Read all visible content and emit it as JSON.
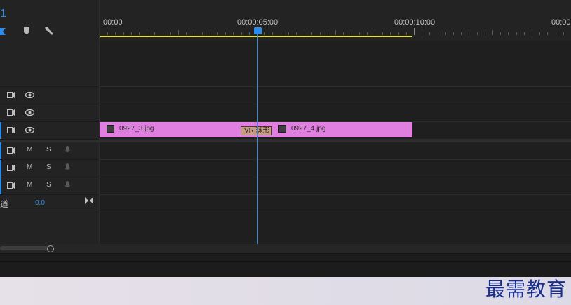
{
  "sequence": {
    "number_partial": "1"
  },
  "ruler": {
    "timecodes": [
      ":00:00",
      "00:00:05:00",
      "00:00:10:00",
      "00:00"
    ]
  },
  "video_tracks": [
    {
      "id": "V3"
    },
    {
      "id": "V2"
    },
    {
      "id": "V1"
    }
  ],
  "audio_tracks": [
    {
      "id": "A1",
      "mute": "M",
      "solo": "S"
    },
    {
      "id": "A2",
      "mute": "M",
      "solo": "S"
    },
    {
      "id": "A3",
      "mute": "M",
      "solo": "S"
    }
  ],
  "master": {
    "label_partial": "道",
    "value": "0.0"
  },
  "clips": [
    {
      "name": "0927_3.jpg"
    },
    {
      "name": "0927_4.jpg"
    }
  ],
  "transition": {
    "label": "VR 球形"
  },
  "watermark": "最需教育",
  "colors": {
    "accent": "#2d8ceb",
    "clip": "#e07fe0",
    "workbar": "#e6e239"
  }
}
